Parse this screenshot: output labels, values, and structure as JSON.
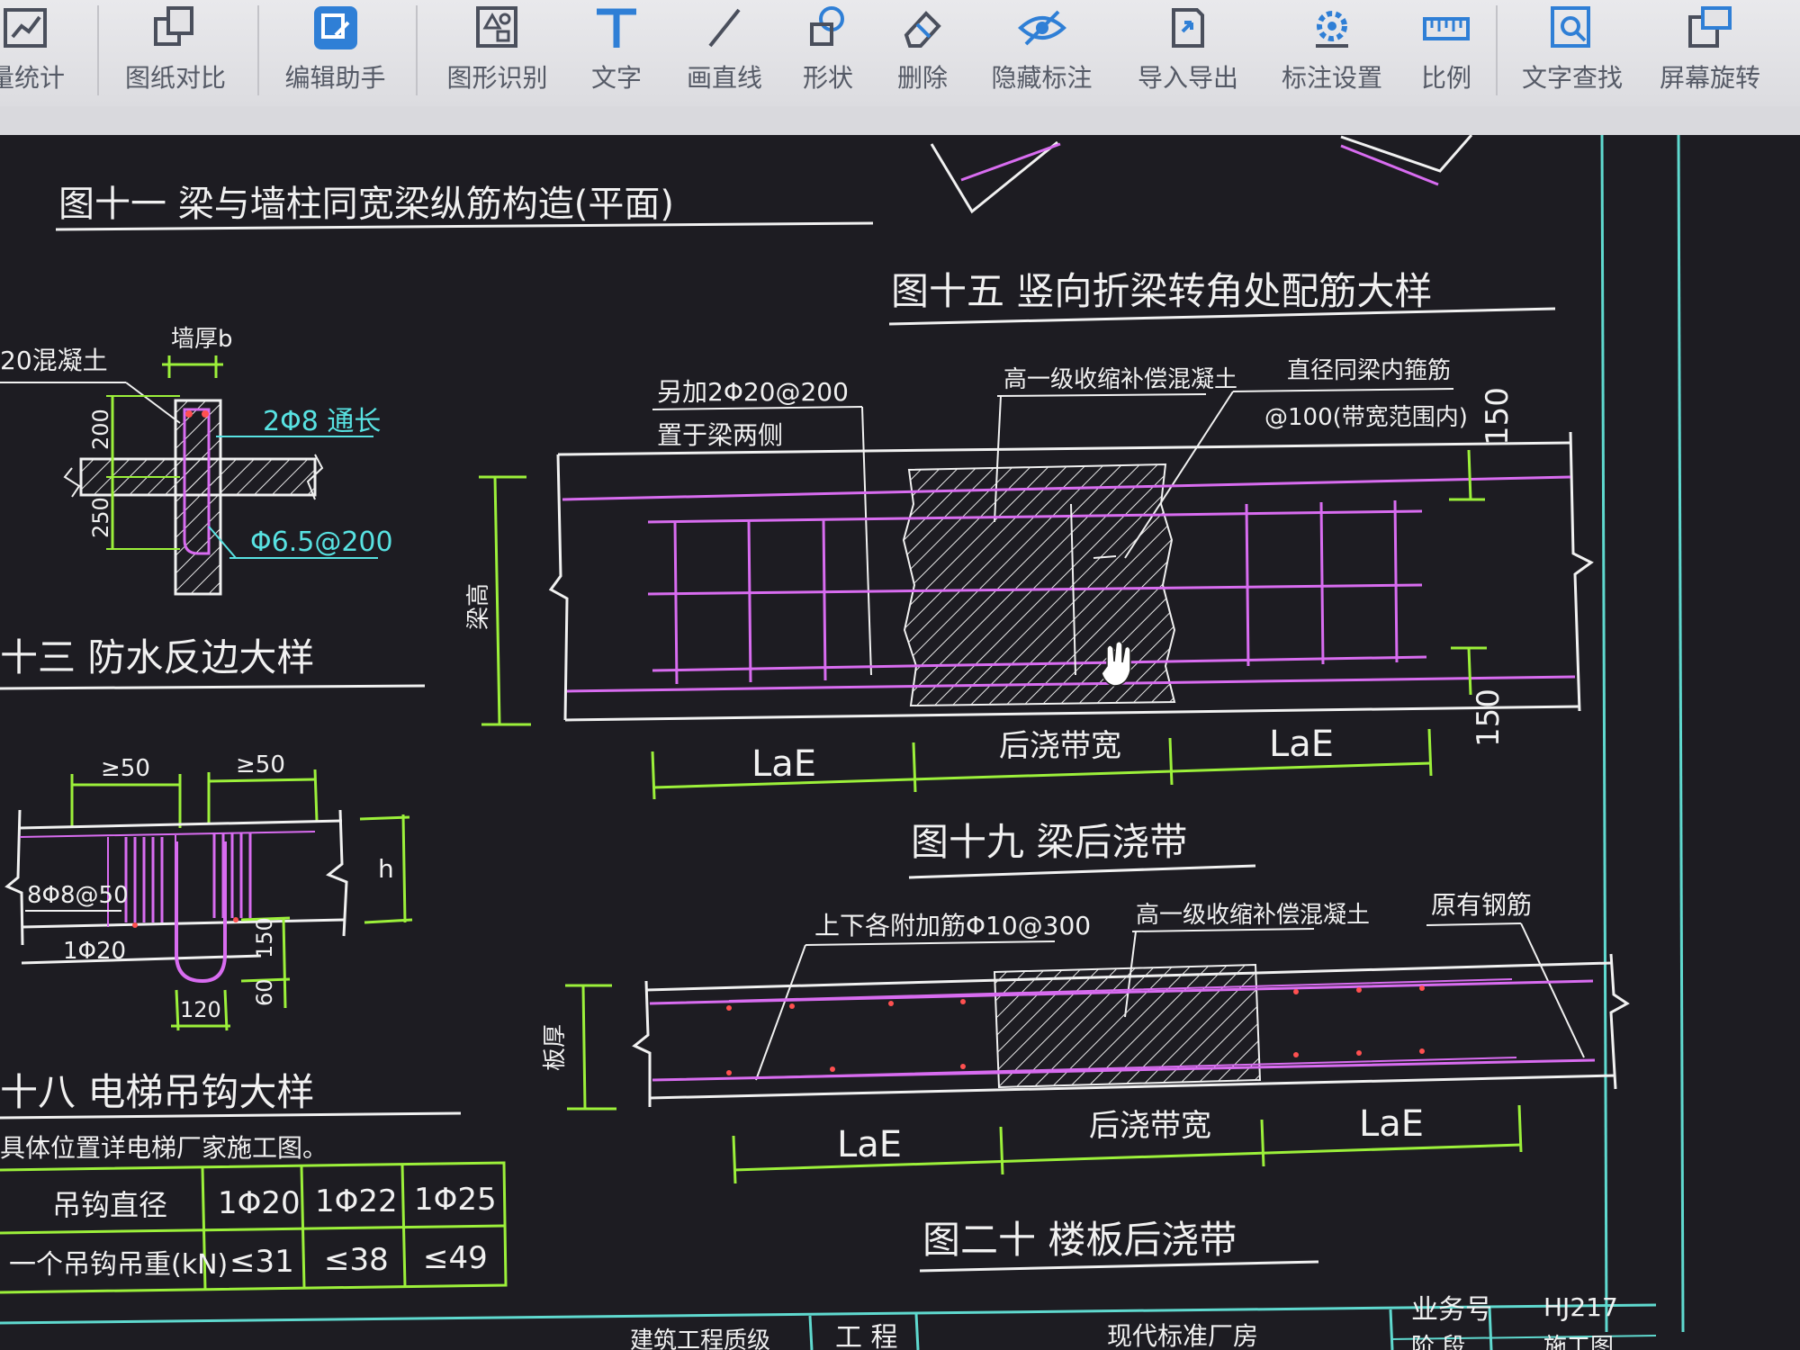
{
  "toolbar": {
    "items": [
      {
        "label": "量统计",
        "icon": "quantity-icon"
      },
      {
        "label": "图纸对比",
        "icon": "compare-icon"
      },
      {
        "label": "编辑助手",
        "icon": "edit-assistant-icon"
      },
      {
        "label": "图形识别",
        "icon": "shape-recognition-icon"
      },
      {
        "label": "文字",
        "icon": "text-icon"
      },
      {
        "label": "画直线",
        "icon": "line-icon"
      },
      {
        "label": "形状",
        "icon": "shape-icon"
      },
      {
        "label": "删除",
        "icon": "eraser-icon"
      },
      {
        "label": "隐藏标注",
        "icon": "eye-hide-icon"
      },
      {
        "label": "导入导出",
        "icon": "import-export-icon"
      },
      {
        "label": "标注设置",
        "icon": "annotation-settings-icon"
      },
      {
        "label": "比例",
        "icon": "ruler-icon"
      },
      {
        "label": "文字查找",
        "icon": "text-search-icon"
      },
      {
        "label": "屏幕旋转",
        "icon": "screen-rotate-icon"
      }
    ],
    "accent": "#2f7fd6"
  },
  "drawing": {
    "fig11": {
      "title": "图十一 梁与墙柱同宽梁纵筋构造(平面)"
    },
    "fig13": {
      "title": "十三 防水反边大样",
      "wall_label": "墙厚b",
      "concrete_label": "20混凝土",
      "dim_200": "200",
      "dim_250": "250",
      "rebar_top": "2Φ8 通长",
      "stirrup": "Φ6.5@200"
    },
    "fig15": {
      "title": "图十五 竖向折梁转角处配筋大样",
      "note1_line1": "另加2Φ20@200",
      "note1_line2": "置于梁两侧",
      "note2": "高一级收缩补偿混凝土",
      "note3_line1": "直径同梁内箍筋",
      "note3_line2": "@100(带宽范围内)",
      "dim_150_top": "150",
      "dim_150_bottom": "150",
      "beam_height": "梁高"
    },
    "fig19": {
      "title": "图十九 梁后浇带",
      "dim_left": "LaE",
      "dim_mid": "后浇带宽",
      "dim_right": "LaE"
    },
    "fig18": {
      "title": "十八 电梯吊钩大样",
      "dim_50a": "≥50",
      "dim_50b": "≥50",
      "rebar": "8Φ8@50",
      "dim_1020": "1Φ20",
      "dim_150": "150",
      "dim_120": "120",
      "dim_60": "60",
      "h_label": "h",
      "note": "具体位置详电梯厂家施工图。"
    },
    "hook_table": {
      "header": "吊钩直径",
      "cols": [
        "1Φ20",
        "1Φ22",
        "1Φ25"
      ],
      "row_label": "一个吊钩吊重(kN)",
      "values": [
        "≤31",
        "≤38",
        "≤49"
      ]
    },
    "fig20": {
      "title": "图二十 楼板后浇带",
      "note1": "上下各附加筋Φ10@300",
      "note2": "高一级收缩补偿混凝土",
      "note3": "原有钢筋",
      "slab_thickness": "板厚",
      "dim_left": "LaE",
      "dim_mid": "后浇带宽",
      "dim_right": "LaE"
    },
    "title_block": {
      "company": "建筑工程质级",
      "project_label": "工 程",
      "project_value": "现代标准厂房",
      "job_label": "业务号",
      "job_value": "HJ217",
      "stage_label": "阶 段",
      "stage_value": "施工图"
    }
  }
}
